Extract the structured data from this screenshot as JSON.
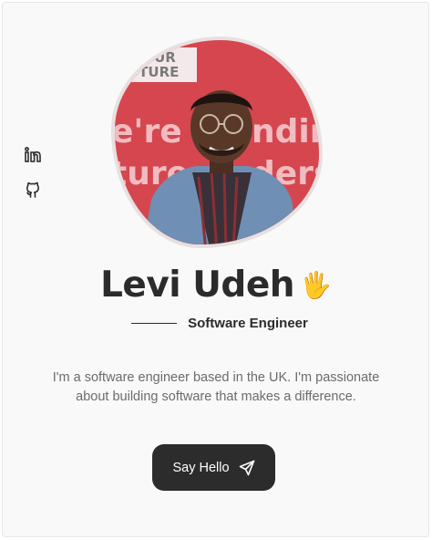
{
  "profile": {
    "name": "Levi Udeh",
    "role": "Software Engineer",
    "bio": "I'm a software engineer based in the UK. I'm passionate about building software that makes a difference.",
    "wave_emoji": "🖐️"
  },
  "social": [
    {
      "icon": "linkedin-icon"
    },
    {
      "icon": "github-icon"
    }
  ],
  "avatar_backdrop": {
    "sign_top": "YOUR\nUTURE",
    "sign_middle": "e're    nding",
    "sign_bottom": "ture    ders"
  },
  "cta": {
    "label": "Say Hello",
    "icon": "send-icon"
  },
  "colors": {
    "background": "#f9f9f9",
    "text": "#2b2b2b",
    "button": "#2c2c2c",
    "backdrop_red": "#d84a52"
  }
}
